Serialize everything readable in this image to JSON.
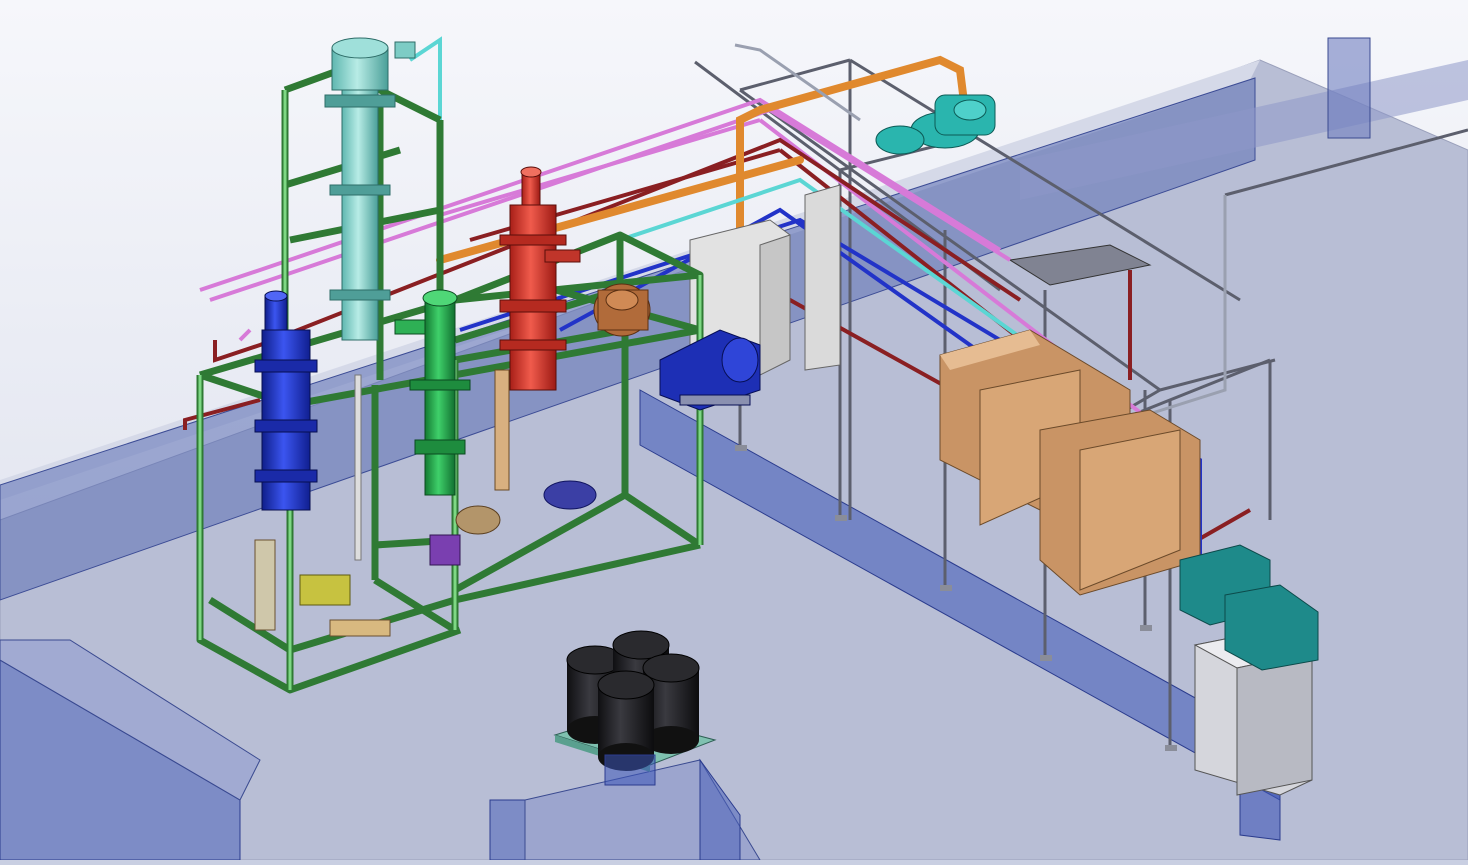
{
  "scene": {
    "kind": "isometric-cad-model",
    "colors": {
      "background_top": "#f3f5fa",
      "floor": "#b9bfd6",
      "wall_translucent": "#4c5fa9",
      "frame_green": "#5dbb63",
      "column_cyan": "#77c9c2",
      "column_red": "#d8362b",
      "column_blue": "#1f35c8",
      "column_green": "#22a84a",
      "pipe_orange": "#e0892e",
      "pipe_magenta": "#d77ad8",
      "pipe_darkred": "#8a1f22",
      "rack_gray": "#6e7180",
      "tank_tan": "#d8a676",
      "cabinet_light": "#dedede",
      "drum_black": "#1f1f22",
      "motor_teal": "#1e8a8a"
    }
  },
  "components": [
    {
      "id": "condenser-column",
      "icon": "heat-exchanger-icon"
    },
    {
      "id": "red-column",
      "icon": "vessel-icon"
    },
    {
      "id": "blue-column",
      "icon": "vessel-icon"
    },
    {
      "id": "green-column",
      "icon": "vessel-icon"
    },
    {
      "id": "green-structural-frame",
      "icon": "frame-icon"
    },
    {
      "id": "pipe-rack",
      "icon": "rack-icon"
    },
    {
      "id": "storage-tanks",
      "icon": "tank-icon"
    },
    {
      "id": "control-cabinet",
      "icon": "cabinet-icon"
    },
    {
      "id": "drum-cluster",
      "icon": "drum-icon"
    },
    {
      "id": "pump-skid",
      "icon": "pump-icon"
    }
  ]
}
